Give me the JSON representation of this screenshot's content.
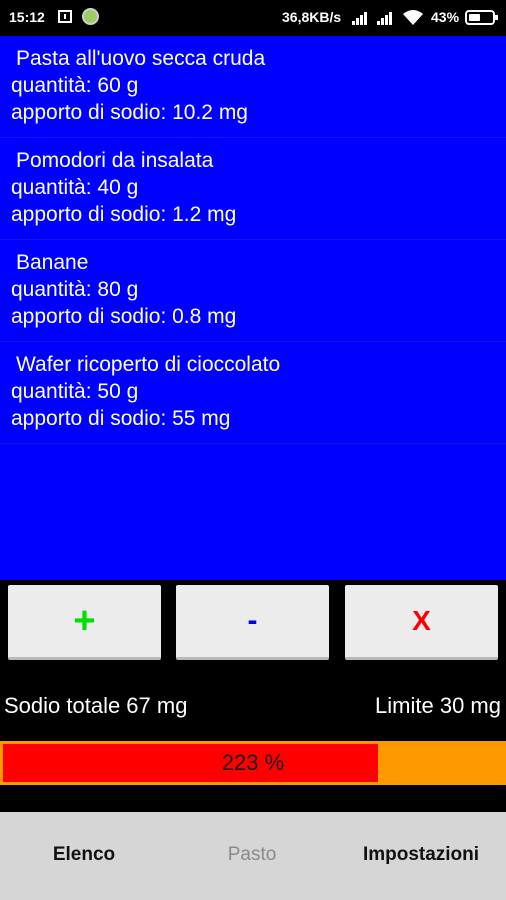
{
  "status_bar": {
    "time": "15:12",
    "network_speed": "36,8KB/s",
    "battery_percent": "43%",
    "icons": [
      "notification-icon",
      "app-icon",
      "signal-icon",
      "wifi-icon",
      "battery-icon"
    ]
  },
  "food_list": {
    "background_color": "#0000ff",
    "items": [
      {
        "name": "Pasta all'uovo secca cruda",
        "quantity": "quantità: 60 g",
        "sodium": "apporto di sodio: 10.2 mg"
      },
      {
        "name": "Pomodori da insalata",
        "quantity": "quantità: 40 g",
        "sodium": "apporto di sodio: 1.2 mg"
      },
      {
        "name": "Banane",
        "quantity": "quantità: 80 g",
        "sodium": "apporto di sodio: 0.8 mg"
      },
      {
        "name": "Wafer ricoperto di cioccolato",
        "quantity": "quantità: 50 g",
        "sodium": "apporto di sodio: 55 mg"
      }
    ]
  },
  "buttons": {
    "add": {
      "label": "+",
      "color": "#00e000"
    },
    "remove": {
      "label": "-",
      "color": "#0000ff"
    },
    "clear": {
      "label": "X",
      "color": "#ff0000"
    }
  },
  "totals": {
    "total_sodium": "Sodio totale 67  mg",
    "limit": "Limite 30  mg"
  },
  "progress": {
    "label": "223 %",
    "fill_fraction": 0.75,
    "fill_color": "#ff0000",
    "track_color": "#ff9900"
  },
  "bottom_nav": {
    "tabs": [
      {
        "label": "Elenco",
        "state": "enabled"
      },
      {
        "label": "Pasto",
        "state": "disabled"
      },
      {
        "label": "Impostazioni",
        "state": "enabled"
      }
    ]
  }
}
